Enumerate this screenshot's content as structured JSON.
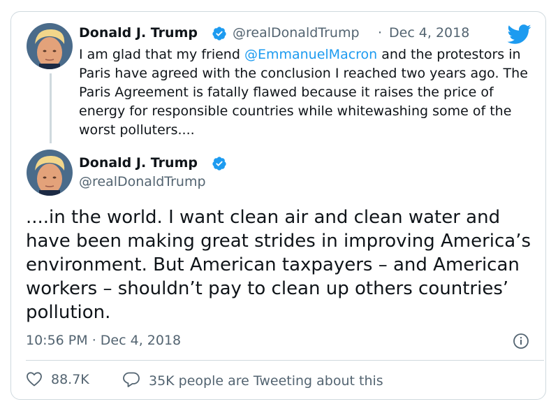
{
  "tweet1": {
    "name": "Donald J. Trump",
    "handle": "@realDonaldTrump",
    "separator": "·",
    "date": "Dec 4, 2018",
    "text_before": "I am glad that my friend ",
    "mention": "@EmmanuelMacron",
    "text_after": " and the protestors in Paris have agreed with the conclusion I reached two years ago. The Paris Agreement is fatally flawed because it raises the price of energy for responsible countries while whitewashing some of the worst polluters...."
  },
  "tweet2": {
    "name": "Donald J. Trump",
    "handle": "@realDonaldTrump",
    "text": "....in the world. I want clean air and clean water and have been making great strides in improving America’s environment. But American taxpayers – and American workers – shouldn’t pay to clean up others countries’ pollution.",
    "time": "10:56 PM",
    "separator": "·",
    "date": "Dec 4, 2018"
  },
  "actions": {
    "likes": "88.7K",
    "tweeting": "35K people are Tweeting about this"
  },
  "colors": {
    "link": "#1d9bf0",
    "secondary_text": "#536471",
    "border": "#cfd9de",
    "verified": "#1d9bf0"
  },
  "icons": [
    "twitter-bird-icon",
    "verified-badge-icon",
    "info-icon",
    "heart-icon",
    "speech-bubble-icon"
  ]
}
